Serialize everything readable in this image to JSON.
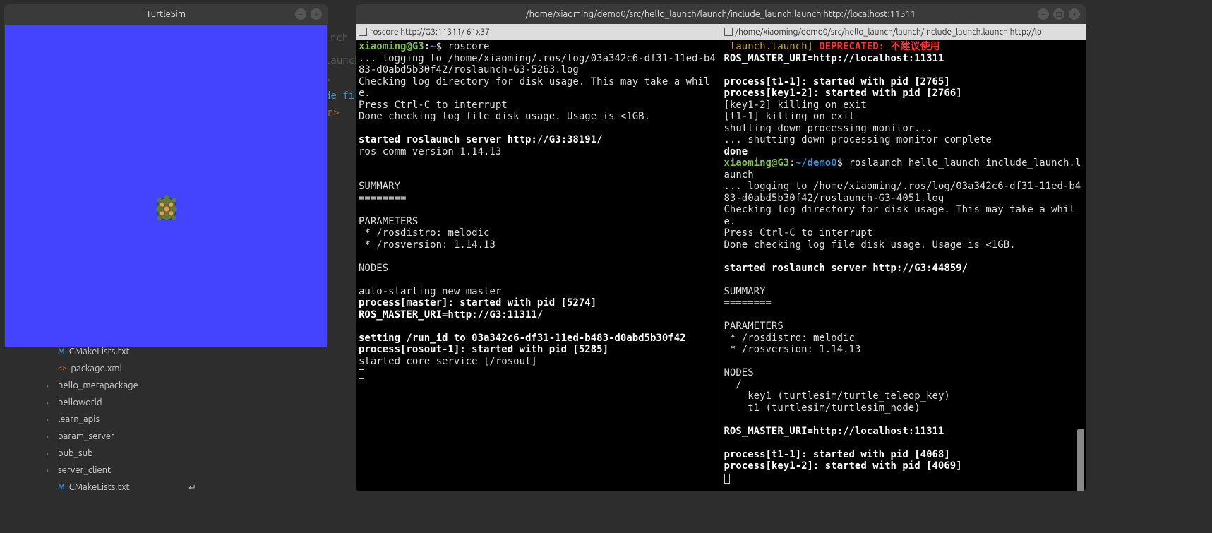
{
  "turtlesim": {
    "title": "TurtleSim"
  },
  "background_fragments": {
    "f1": "nch",
    "f2": "launch",
    "f3": ">",
    "f4": "de fi",
    "f5": "n>"
  },
  "file_tree": {
    "item0": "CMakeLists.txt",
    "item1": "package.xml",
    "item2": "hello_metapackage",
    "item3": "helloworld",
    "item4": "learn_apis",
    "item5": "param_server",
    "item6": "pub_sub",
    "item7": "server_client",
    "item8": "CMakeLists.txt"
  },
  "terminal": {
    "title": "/home/xiaoming/demo0/src/hello_launch/launch/include_launch.launch http://localhost:11311",
    "left_tab": "roscore http://G3:11311/ 61x37",
    "right_tab": "/home/xiaoming/demo0/src/hello_launch/launch/include_launch.launch http://lo",
    "left": {
      "prompt_user": "xiaoming@G3",
      "prompt_path": "~",
      "cmd": "roscore",
      "l1": "... logging to /home/xiaoming/.ros/log/03a342c6-df31-11ed-b483-d0abd5b30f42/roslaunch-G3-5263.log",
      "l2": "Checking log directory for disk usage. This may take a while.",
      "l3": "Press Ctrl-C to interrupt",
      "l4": "Done checking log file disk usage. Usage is <1GB.",
      "l5": "started roslaunch server http://G3:38191/",
      "l6": "ros_comm version 1.14.13",
      "l7": "SUMMARY",
      "l8": "========",
      "l9": "PARAMETERS",
      "l10": " * /rosdistro: melodic",
      "l11": " * /rosversion: 1.14.13",
      "l12": "NODES",
      "l13": "auto-starting new master",
      "l14": "process[master]: started with pid [5274]",
      "l15": "ROS_MASTER_URI=http://G3:11311/",
      "l16": "setting /run_id to 03a342c6-df31-11ed-b483-d0abd5b30f42",
      "l17": "process[rosout-1]: started with pid [5285]",
      "l18": "started core service [/rosout]"
    },
    "right": {
      "r0a": "_launch.launch]",
      "r0b": " DEPRECATED: 不建议使用",
      "r1": "ROS_MASTER_URI=http://localhost:11311",
      "r2": "process[t1-1]: started with pid [2765]",
      "r3": "process[key1-2]: started with pid [2766]",
      "r4": "[key1-2] killing on exit",
      "r5": "[t1-1] killing on exit",
      "r6": "shutting down processing monitor...",
      "r7": "... shutting down processing monitor complete",
      "r8": "done",
      "prompt_user": "xiaoming@G3",
      "prompt_path": "~/demo0",
      "cmd": "roslaunch hello_launch include_launch.launch",
      "r9": "... logging to /home/xiaoming/.ros/log/03a342c6-df31-11ed-b483-d0abd5b30f42/roslaunch-G3-4051.log",
      "r10": "Checking log directory for disk usage. This may take a while.",
      "r11": "Press Ctrl-C to interrupt",
      "r12": "Done checking log file disk usage. Usage is <1GB.",
      "r13": "started roslaunch server http://G3:44859/",
      "r14": "SUMMARY",
      "r15": "========",
      "r16": "PARAMETERS",
      "r17": " * /rosdistro: melodic",
      "r18": " * /rosversion: 1.14.13",
      "r19": "NODES",
      "r20": "  /",
      "r21": "    key1 (turtlesim/turtle_teleop_key)",
      "r22": "    t1 (turtlesim/turtlesim_node)",
      "r23": "ROS_MASTER_URI=http://localhost:11311",
      "r24": "process[t1-1]: started with pid [4068]",
      "r25": "process[key1-2]: started with pid [4069]"
    }
  }
}
